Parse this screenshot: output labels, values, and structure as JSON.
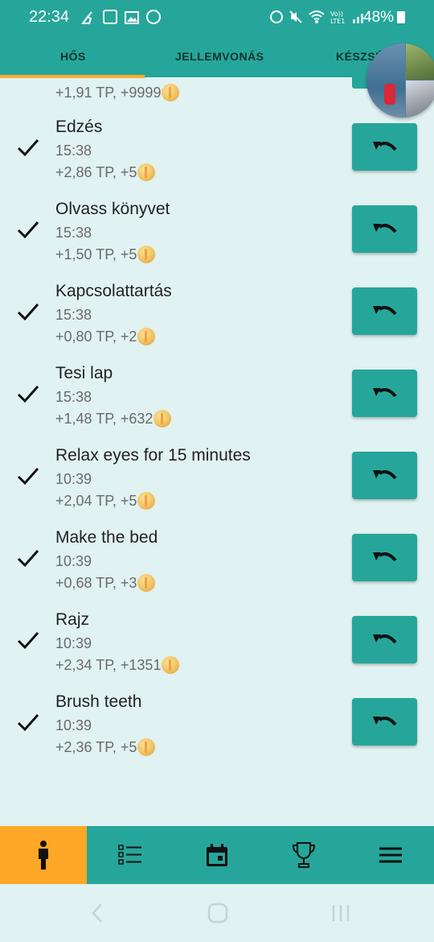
{
  "status_bar": {
    "time": "22:34",
    "battery": "48%",
    "network_label": "Vo))\nLTE1",
    "left_icons": [
      "cleaner-icon",
      "notification-icon",
      "gallery-icon",
      "messenger-icon"
    ],
    "right_icons": [
      "alarm-icon",
      "mute-icon",
      "wifi-icon",
      "signal-icon",
      "battery-icon"
    ]
  },
  "tabs": [
    {
      "label": "HŐS",
      "active": true
    },
    {
      "label": "JELLEMVONÁS",
      "active": false
    },
    {
      "label": "KÉSZSÉ",
      "active": false
    }
  ],
  "partial_item": {
    "stats": "+1,91 TP, +9999"
  },
  "tasks": [
    {
      "title": "Edzés",
      "time": "15:38",
      "stats": "+2,86 TP, +5"
    },
    {
      "title": "Olvass könyvet",
      "time": "15:38",
      "stats": "+1,50 TP, +5"
    },
    {
      "title": "Kapcsolattartás",
      "time": "15:38",
      "stats": "+0,80 TP, +2"
    },
    {
      "title": "Tesi lap",
      "time": "15:38",
      "stats": "+1,48 TP, +632"
    },
    {
      "title": "Relax eyes for 15 minutes",
      "time": "10:39",
      "stats": "+2,04 TP, +5"
    },
    {
      "title": "Make the bed",
      "time": "10:39",
      "stats": "+0,68 TP, +3"
    },
    {
      "title": "Rajz",
      "time": "10:39",
      "stats": "+2,34 TP, +1351"
    },
    {
      "title": "Brush teeth",
      "time": "10:39",
      "stats": "+2,36 TP, +5"
    }
  ],
  "bottom_nav": [
    {
      "icon": "hero-icon",
      "active": true
    },
    {
      "icon": "list-icon",
      "active": false
    },
    {
      "icon": "calendar-icon",
      "active": false
    },
    {
      "icon": "trophy-icon",
      "active": false
    },
    {
      "icon": "menu-icon",
      "active": false
    }
  ],
  "colors": {
    "primary": "#26a69a",
    "accent": "#ffa726",
    "background": "#e0f2f1"
  }
}
